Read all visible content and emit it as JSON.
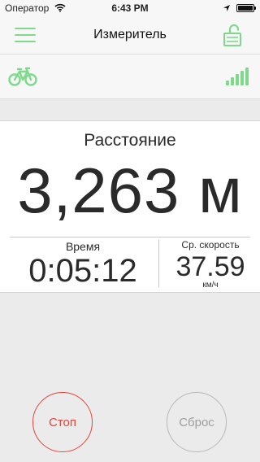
{
  "status_bar": {
    "carrier": "Оператор",
    "time": "6:43 PM",
    "icons": [
      "wifi-icon",
      "location-arrow-icon",
      "battery-icon"
    ]
  },
  "nav": {
    "title": "Измеритель",
    "left_icon": "menu-icon",
    "right_icon": "unlocked-padlock-icon"
  },
  "toolbar": {
    "mode_icon": "bicycle-icon",
    "signal_icon": "gps-signal-icon",
    "signal_bars": 5
  },
  "measurement": {
    "distance_label": "Расстояние",
    "distance_value": "3,263 м",
    "time_label": "Время",
    "time_value": "0:05:12",
    "speed_label": "Ср. скорость",
    "speed_value": "37.59",
    "speed_unit": "км/ч"
  },
  "controls": {
    "stop_label": "Стоп",
    "reset_label": "Сброс"
  },
  "colors": {
    "accent_green": "#7ed98b",
    "stop_red": "#e5443b",
    "reset_gray": "#9e9e9e",
    "background": "#ebebeb"
  }
}
